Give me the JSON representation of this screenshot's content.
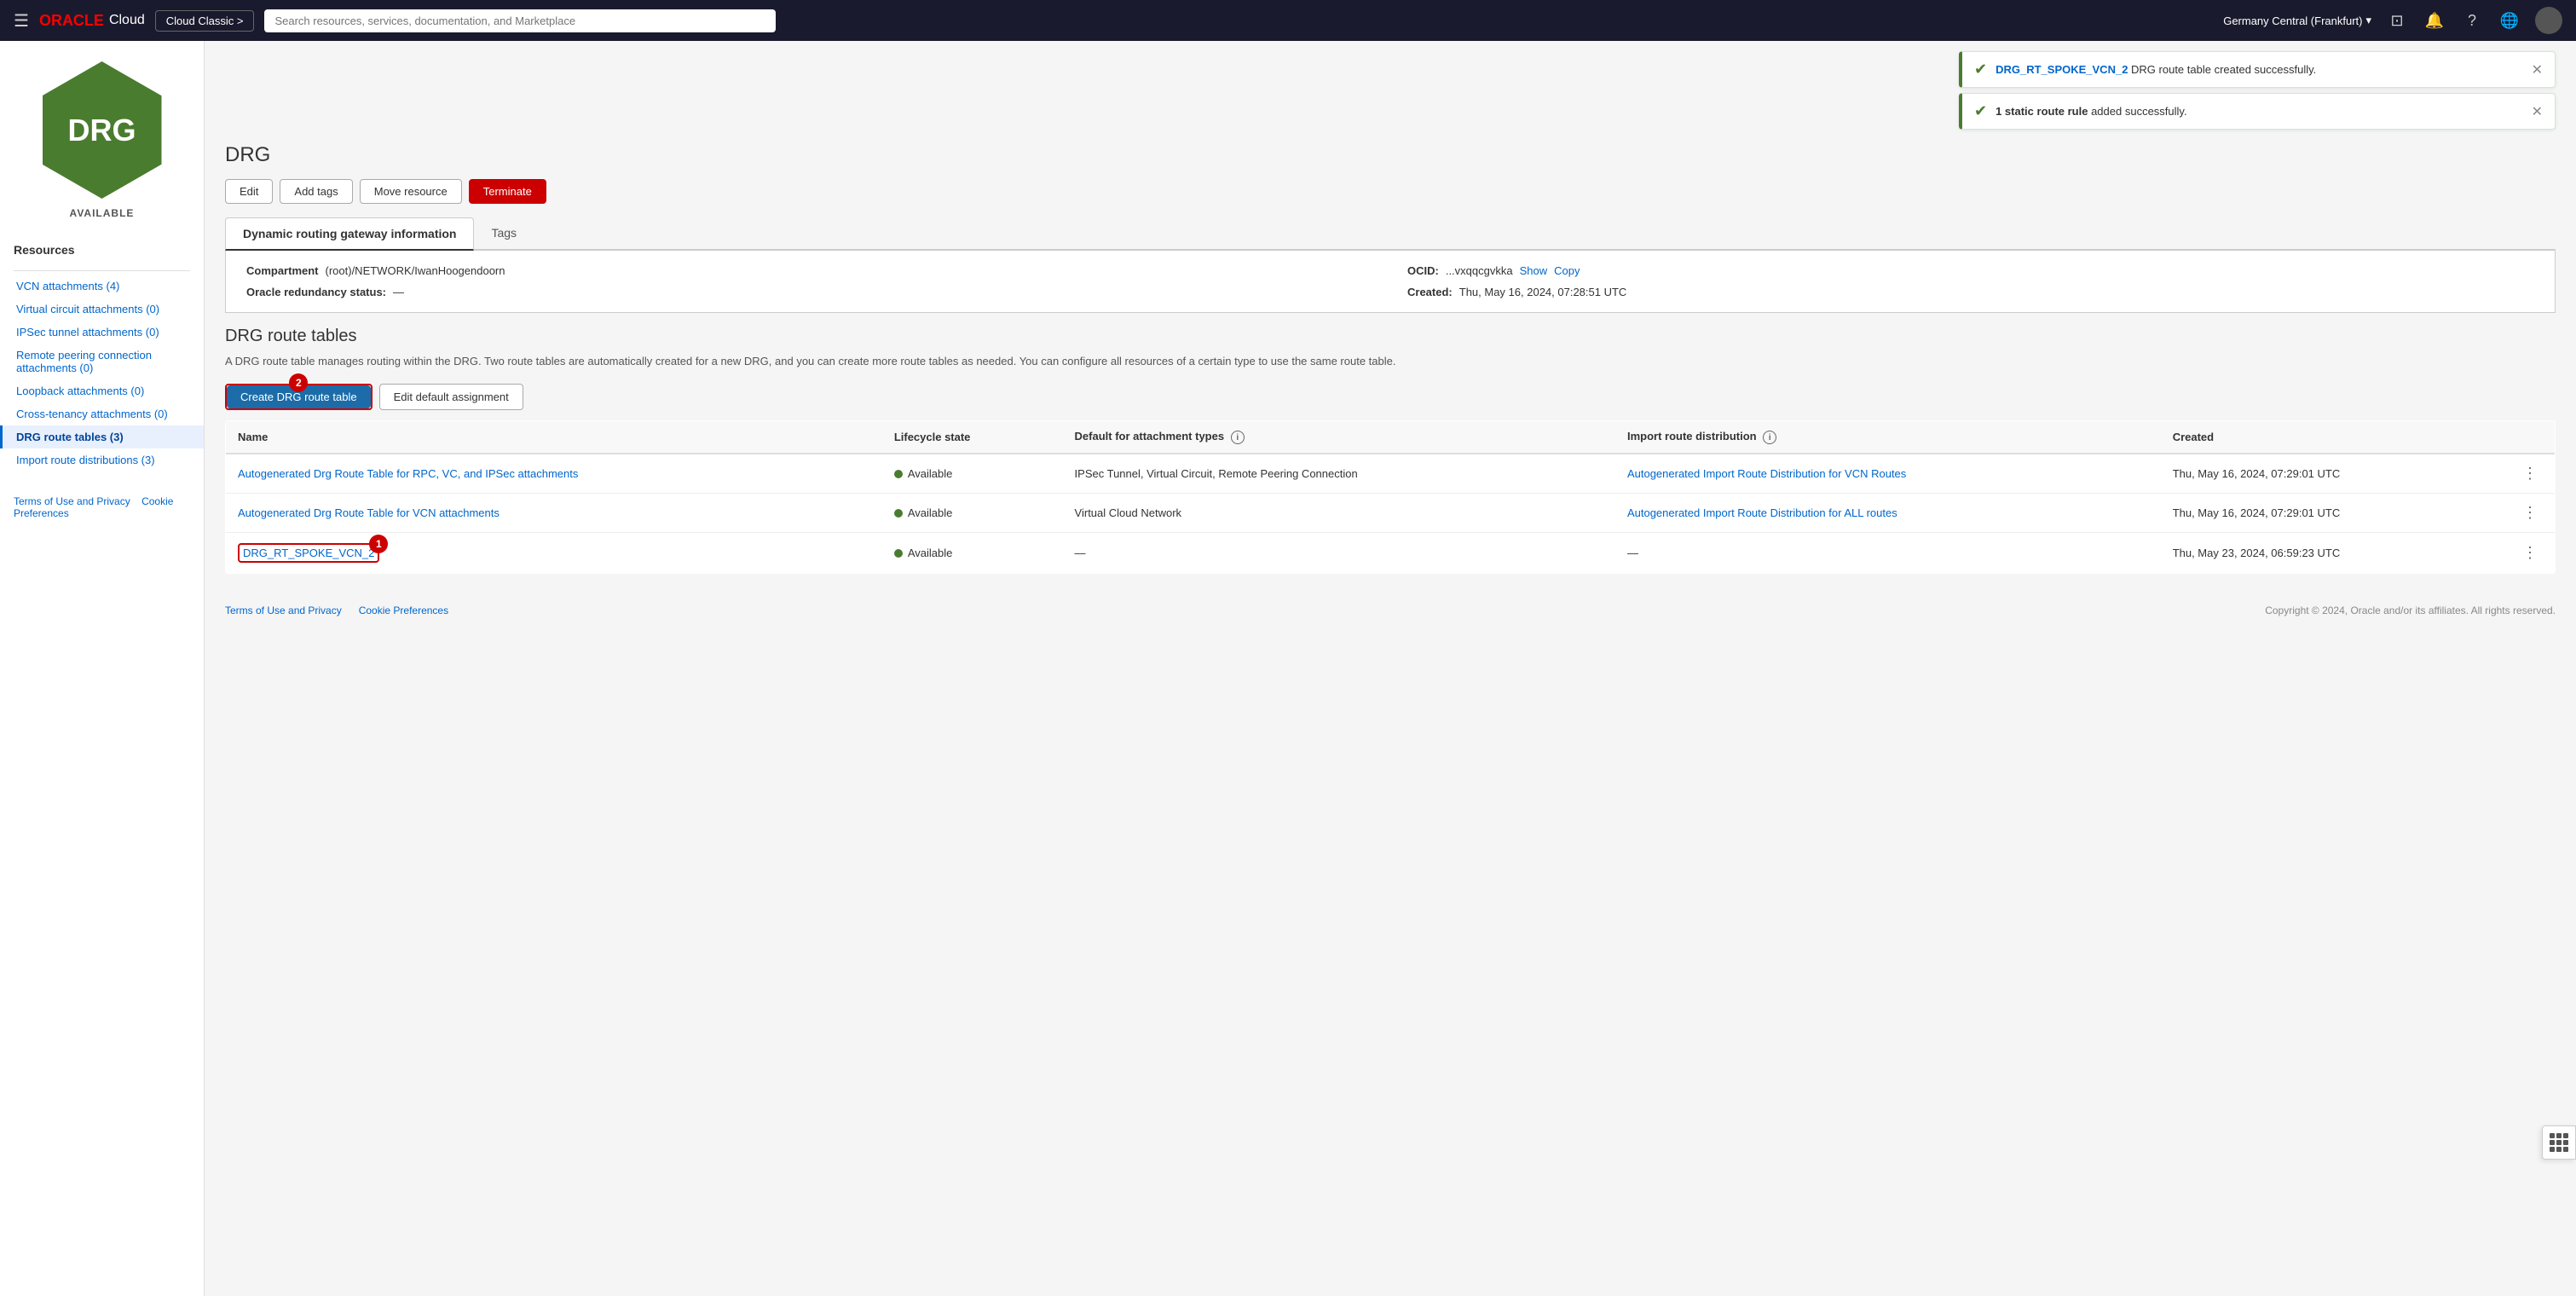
{
  "topnav": {
    "oracle_label": "ORACLE",
    "cloud_label": "Cloud",
    "cloud_classic_label": "Cloud Classic >",
    "search_placeholder": "Search resources, services, documentation, and Marketplace",
    "region": "Germany Central (Frankfurt)",
    "region_arrow": "▾"
  },
  "drg_icon": {
    "text": "DRG",
    "status": "AVAILABLE"
  },
  "notifications": [
    {
      "link_text": "DRG_RT_SPOKE_VCN_2",
      "message": " DRG route table created successfully."
    },
    {
      "message": "1 static route rule added successfully.",
      "bold_prefix": "1 static route rule"
    }
  ],
  "page": {
    "title": "DRG",
    "buttons": {
      "edit": "Edit",
      "add_tags": "Add tags",
      "move_resource": "Move resource",
      "terminate": "Terminate"
    }
  },
  "tabs": {
    "info_tab": "Dynamic routing gateway information",
    "tags_tab": "Tags"
  },
  "info_panel": {
    "compartment_label": "Compartment",
    "compartment_value": "(root)/NETWORK/IwanHoogendoorn",
    "ocid_label": "OCID:",
    "ocid_value": "...vxqqcgvkka",
    "ocid_show": "Show",
    "ocid_copy": "Copy",
    "redundancy_label": "Oracle redundancy status:",
    "redundancy_value": "—",
    "created_label": "Created:",
    "created_value": "Thu, May 16, 2024, 07:28:51 UTC"
  },
  "route_tables": {
    "section_title": "DRG route tables",
    "section_desc": "A DRG route table manages routing within the DRG. Two route tables are automatically created for a new DRG, and you can create more route tables as needed. You can configure all resources of a certain type to use the same route table.",
    "create_button": "Create DRG route table",
    "edit_assignment_button": "Edit default assignment",
    "columns": {
      "name": "Name",
      "lifecycle": "Lifecycle state",
      "default_for": "Default for attachment types",
      "import_dist": "Import route distribution",
      "created": "Created"
    },
    "rows": [
      {
        "name": "Autogenerated Drg Route Table for RPC, VC, and IPSec attachments",
        "lifecycle": "Available",
        "default_for": "IPSec Tunnel, Virtual Circuit, Remote Peering Connection",
        "import_dist": "Autogenerated Import Route Distribution for VCN Routes",
        "created": "Thu, May 16, 2024, 07:29:01 UTC"
      },
      {
        "name": "Autogenerated Drg Route Table for VCN attachments",
        "lifecycle": "Available",
        "default_for": "Virtual Cloud Network",
        "import_dist": "Autogenerated Import Route Distribution for ALL routes",
        "created": "Thu, May 16, 2024, 07:29:01 UTC"
      },
      {
        "name": "DRG_RT_SPOKE_VCN_2",
        "lifecycle": "Available",
        "default_for": "—",
        "import_dist": "—",
        "created": "Thu, May 23, 2024, 06:59:23 UTC"
      }
    ]
  },
  "sidebar": {
    "resources_title": "Resources",
    "links": [
      {
        "label": "VCN attachments (4)",
        "active": false
      },
      {
        "label": "Virtual circuit attachments (0)",
        "active": false
      },
      {
        "label": "IPSec tunnel attachments (0)",
        "active": false
      },
      {
        "label": "Remote peering connection attachments (0)",
        "active": false
      },
      {
        "label": "Loopback attachments (0)",
        "active": false
      },
      {
        "label": "Cross-tenancy attachments (0)",
        "active": false
      },
      {
        "label": "DRG route tables (3)",
        "active": true
      },
      {
        "label": "Import route distributions (3)",
        "active": false
      }
    ]
  },
  "footer": {
    "terms": "Terms of Use and Privacy",
    "cookies": "Cookie Preferences",
    "copyright": "Copyright © 2024, Oracle and/or its affiliates. All rights reserved."
  }
}
